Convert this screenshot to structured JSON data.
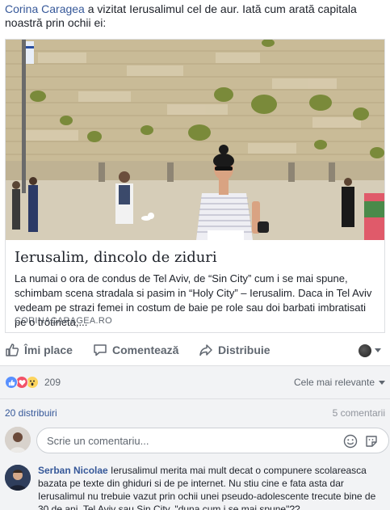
{
  "post": {
    "author": "Corina Caragea",
    "text": " a vizitat Ierusalimul cel de aur. Iată cum arată capitala noastră prin ochii ei:"
  },
  "link_card": {
    "title": "Ierusalim, dincolo de ziduri",
    "description": "La numai o ora de condus de Tel Aviv, de “Sin City” cum i se mai spune, schimbam scena stradala si pasim in “Holy City” – Ierusalim. Daca in Tel Aviv vedeam pe strazi femei in costum de baie pe role sau doi barbati imbratisati pe o trotineta,...",
    "domain": "CORINACARAGEA.RO"
  },
  "actions": {
    "like": "Îmi place",
    "comment": "Comentează",
    "share": "Distribuie"
  },
  "reactions": {
    "count": "209",
    "sort_label": "Cele mai relevante",
    "colors": {
      "like": "#5890ff",
      "love": "#f25268",
      "wow": "#fcd45e"
    }
  },
  "stats": {
    "shares": "20 distribuiri",
    "comments": "5 comentarii"
  },
  "composer": {
    "placeholder": "Scrie un comentariu..."
  },
  "comment": {
    "author": "Serban Nicolae",
    "text": " Ierusalimul merita mai mult decat o compunere scolareasca bazata pe texte din ghiduri si de pe internet. Nu stiu cine e fata asta dar Ierusalimul nu trebuie vazut prin ochii unei pseudo-adolescente trecute bine de 30 de ani. Tel Aviv sau Sin City, \"duna cum i se mai spune\"??"
  },
  "theme": {
    "link_color": "#365899",
    "text_color": "#1d2129",
    "muted_color": "#606770"
  }
}
